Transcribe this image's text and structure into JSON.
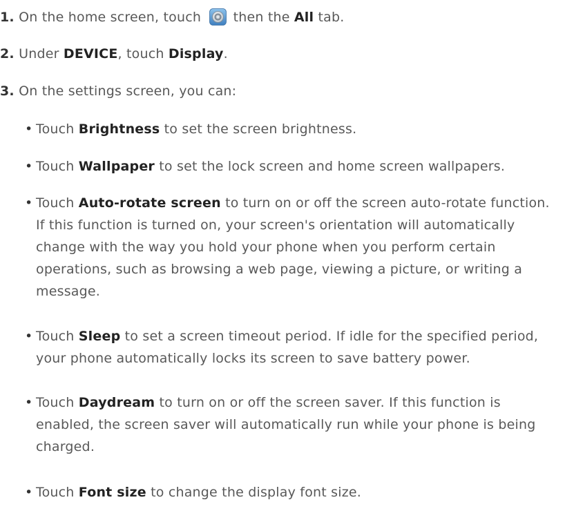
{
  "steps": [
    {
      "number": "1.",
      "text_before_icon": "On the home screen, touch",
      "icon": "settings-gear-icon",
      "text_after_icon": "then the",
      "bold": "All",
      "text_end": "tab."
    },
    {
      "number": "2.",
      "text1": "Under",
      "bold1": "DEVICE",
      "text2": ", touch",
      "bold2": "Display",
      "text3": "."
    },
    {
      "number": "3.",
      "text": "On the settings screen, you can:"
    }
  ],
  "bullets": [
    {
      "prefix": "Touch",
      "bold": "Brightness",
      "rest": "to set the screen brightness."
    },
    {
      "prefix": "Touch",
      "bold": "Wallpaper",
      "rest": "to set the lock screen and home screen wallpapers."
    },
    {
      "prefix": "Touch",
      "bold": "Auto-rotate screen",
      "rest": "to turn on or off the screen auto-rotate function. If this function is turned on, your screen's orientation will automatically change with the way you hold your phone when you perform certain operations, such as browsing a web page, viewing a picture, or writing a message."
    },
    {
      "prefix": "Touch",
      "bold": "Sleep",
      "rest": "to set a screen timeout period. If idle for the specified period, your phone automatically locks its screen to save battery power."
    },
    {
      "prefix": "Touch",
      "bold": "Daydream",
      "rest": "to turn on or off the screen saver. If this function is enabled, the screen saver will automatically run while your phone is being charged."
    },
    {
      "prefix": "Touch",
      "bold": "Font size",
      "rest": "to change the display font size."
    }
  ],
  "bullet_symbol": "•",
  "colors": {
    "text": "#585858",
    "bold": "#222222",
    "icon_blue": "#4a8ec9"
  }
}
